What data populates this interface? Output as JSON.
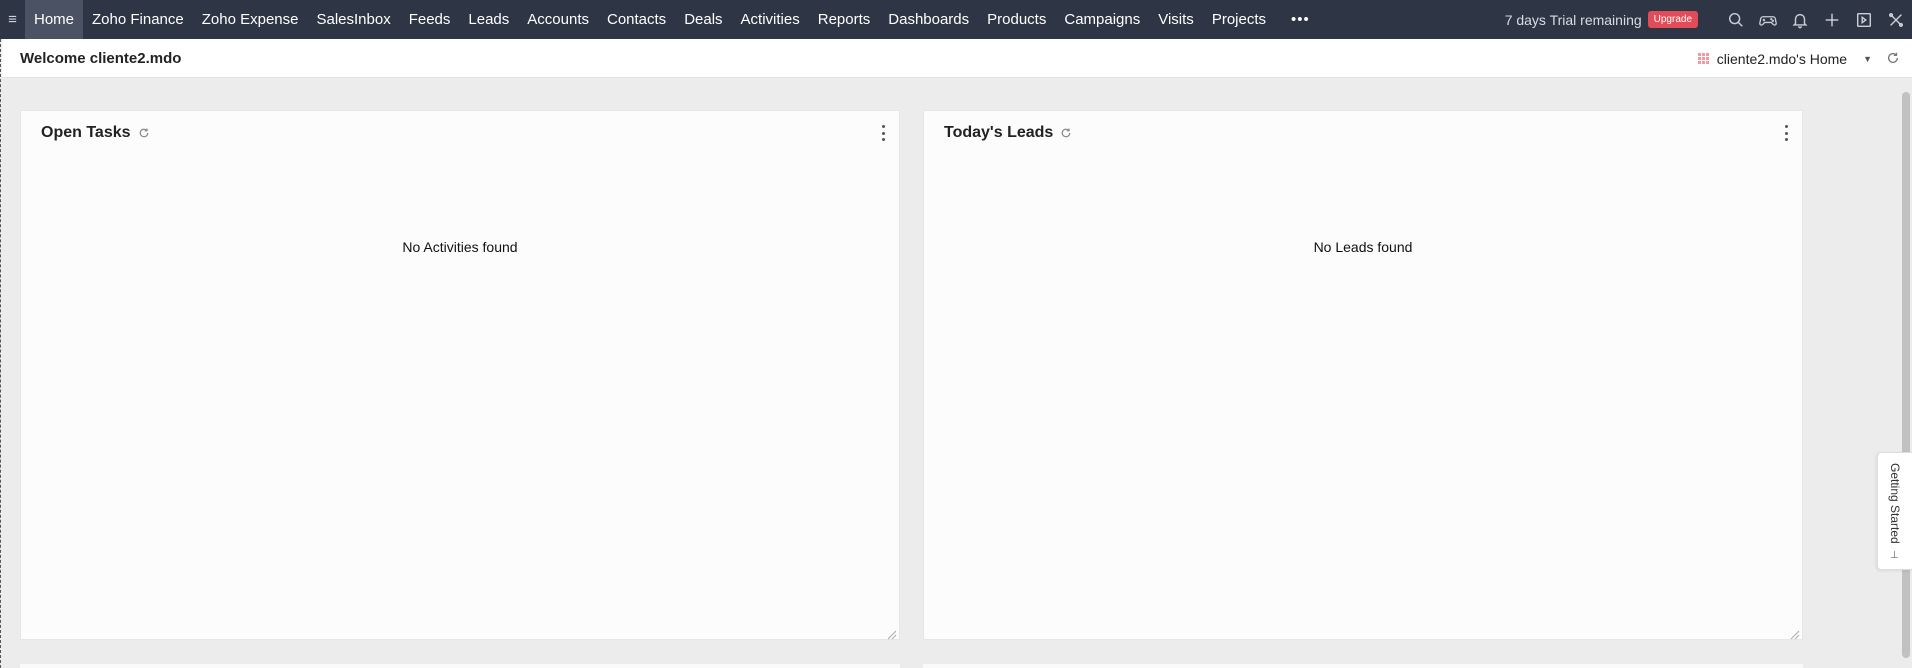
{
  "nav": {
    "menu_icon": "hamburger-icon",
    "items": [
      {
        "label": "Home",
        "active": true
      },
      {
        "label": "Zoho Finance"
      },
      {
        "label": "Zoho Expense"
      },
      {
        "label": "SalesInbox"
      },
      {
        "label": "Feeds"
      },
      {
        "label": "Leads"
      },
      {
        "label": "Accounts"
      },
      {
        "label": "Contacts"
      },
      {
        "label": "Deals"
      },
      {
        "label": "Activities"
      },
      {
        "label": "Reports"
      },
      {
        "label": "Dashboards"
      },
      {
        "label": "Products"
      },
      {
        "label": "Campaigns"
      },
      {
        "label": "Visits"
      },
      {
        "label": "Projects"
      }
    ],
    "more_label": "•••",
    "trial_text": "7 days Trial remaining",
    "upgrade_label": "Upgrade",
    "upgrade_color": "#e24b58",
    "icons": [
      "search-icon",
      "gamepad-icon",
      "bell-icon",
      "plus-icon",
      "calendar-icon",
      "settings-icon"
    ]
  },
  "subheader": {
    "welcome": "Welcome cliente2.mdo",
    "home_select": "cliente2.mdo's Home"
  },
  "panels": {
    "open_tasks": {
      "title": "Open Tasks",
      "empty_message": "No Activities found"
    },
    "todays_leads": {
      "title": "Today's Leads",
      "empty_message": "No Leads found"
    }
  },
  "getting_started": {
    "label": "Getting Started"
  },
  "colors": {
    "topbar_bg": "#2e3544",
    "active_tab_bg": "#4a5263",
    "page_bg": "#ececec"
  }
}
